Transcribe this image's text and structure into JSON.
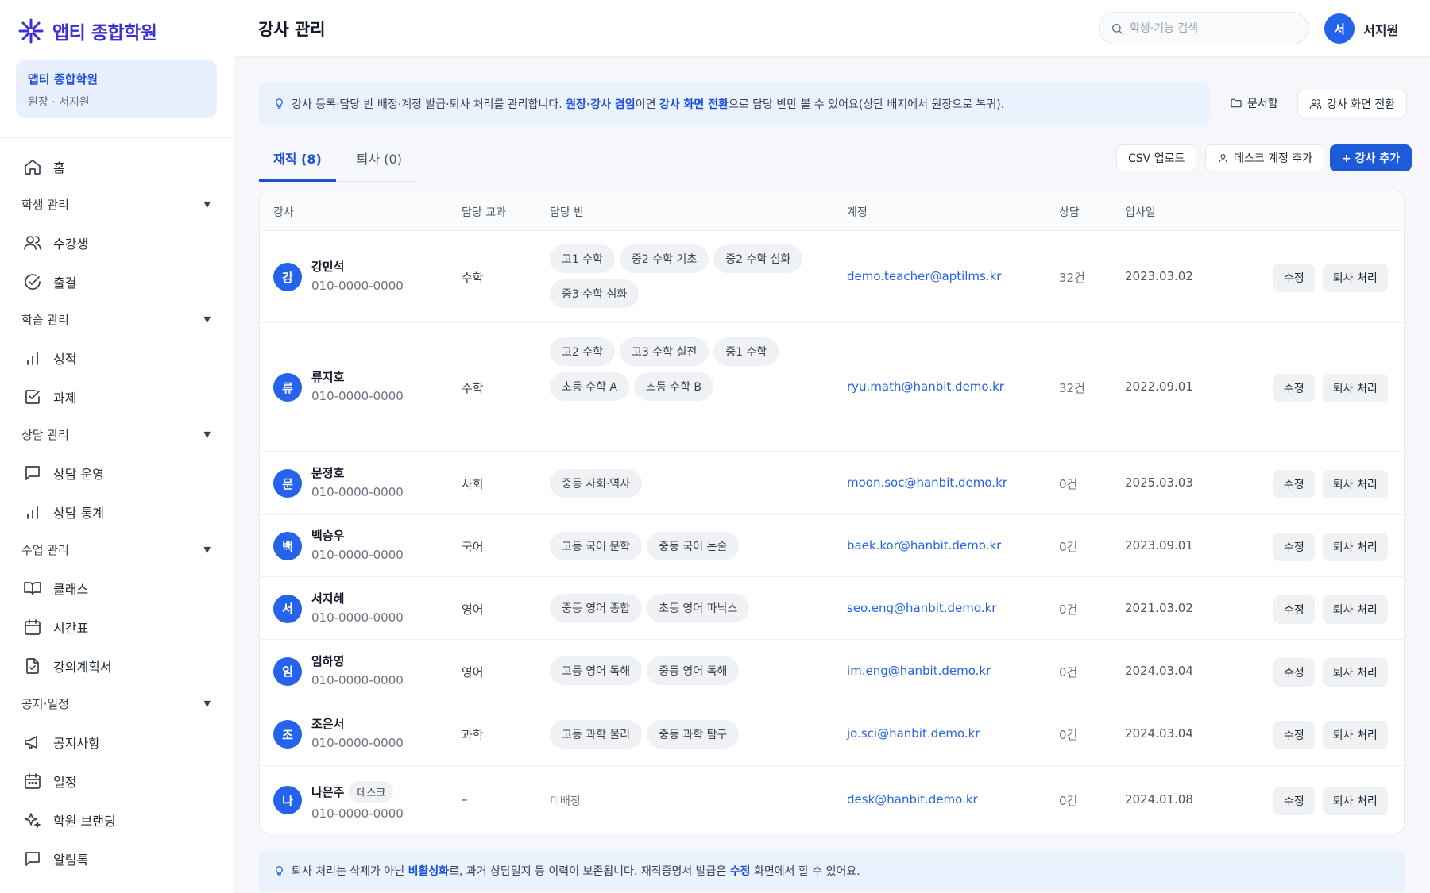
{
  "brand": {
    "name": "앱티 종합학원"
  },
  "org": {
    "name": "앱티 종합학원",
    "role": "원장 · 서지원"
  },
  "nav": {
    "home": "홈",
    "group_students": "학생 관리",
    "students": "수강생",
    "attendance": "출결",
    "group_learning": "학습 관리",
    "grades": "성적",
    "assignments": "과제",
    "group_consult": "상담 관리",
    "consult_ops": "상담 운영",
    "consult_stats": "상담 통계",
    "group_class": "수업 관리",
    "classes": "클래스",
    "timetable": "시간표",
    "syllabus": "강의계획서",
    "group_notice": "공지·일정",
    "notices": "공지사항",
    "schedule": "일정",
    "branding": "학원 브랜딩",
    "alimtalk": "알림톡"
  },
  "header": {
    "title": "강사 관리",
    "search_placeholder": "학생·기능 검색",
    "avatar": "서",
    "user": "서지원"
  },
  "info": {
    "p1": "강사 등록·담당 반 배정·계정 발급·퇴사 처리를 관리합니다. ",
    "b1": "원장·강사 겸임",
    "p2": "이면 ",
    "b2": "강사 화면 전환",
    "p3": "으로 담당 반만 볼 수 있어요(상단 배지에서 원장으로 복귀)."
  },
  "actions": {
    "docs": "문서함",
    "switch": "강사 화면 전환",
    "csv": "CSV 업로드",
    "add_desk": "데스크 계정 추가",
    "add_teacher": "+ 강사 추가"
  },
  "tabs": {
    "active": "재직 (8)",
    "retired": "퇴사 (0)"
  },
  "table": {
    "headers": {
      "teacher": "강사",
      "subject": "담당 교과",
      "classes": "담당 반",
      "account": "계정",
      "consult": "상담",
      "joined": "입사일"
    },
    "edit": "수정",
    "retire": "퇴사 처리",
    "rows": [
      {
        "initial": "강",
        "name": "강민석",
        "badge": "",
        "phone": "010-0000-0000",
        "subject": "수학",
        "classes": [
          "고1 수학",
          "중2 수학 기초",
          "중2 수학 심화",
          "중3 수학 심화"
        ],
        "email": "demo.teacher@aptilms.kr",
        "consult": "32건",
        "date": "2023.03.02"
      },
      {
        "initial": "류",
        "name": "류지호",
        "badge": "",
        "phone": "010-0000-0000",
        "subject": "수학",
        "classes": [
          "고2 수학",
          "고3 수학 실전",
          "중1 수학",
          "초등 수학 A",
          "초등 수학 B"
        ],
        "email": "ryu.math@hanbit.demo.kr",
        "consult": "32건",
        "date": "2022.09.01"
      },
      {
        "initial": "문",
        "name": "문정호",
        "badge": "",
        "phone": "010-0000-0000",
        "subject": "사회",
        "classes": [
          "중등 사회·역사"
        ],
        "email": "moon.soc@hanbit.demo.kr",
        "consult": "0건",
        "date": "2025.03.03"
      },
      {
        "initial": "백",
        "name": "백승우",
        "badge": "",
        "phone": "010-0000-0000",
        "subject": "국어",
        "classes": [
          "고등 국어 문학",
          "중등 국어 논술"
        ],
        "email": "baek.kor@hanbit.demo.kr",
        "consult": "0건",
        "date": "2023.09.01"
      },
      {
        "initial": "서",
        "name": "서지혜",
        "badge": "",
        "phone": "010-0000-0000",
        "subject": "영어",
        "classes": [
          "중등 영어 종합",
          "초등 영어 파닉스"
        ],
        "email": "seo.eng@hanbit.demo.kr",
        "consult": "0건",
        "date": "2021.03.02"
      },
      {
        "initial": "임",
        "name": "임하영",
        "badge": "",
        "phone": "010-0000-0000",
        "subject": "영어",
        "classes": [
          "고등 영어 독해",
          "중등 영어 독해"
        ],
        "email": "im.eng@hanbit.demo.kr",
        "consult": "0건",
        "date": "2024.03.04"
      },
      {
        "initial": "조",
        "name": "조은서",
        "badge": "",
        "phone": "010-0000-0000",
        "subject": "과학",
        "classes": [
          "고등 과학 물리",
          "중등 과학 탐구"
        ],
        "email": "jo.sci@hanbit.demo.kr",
        "consult": "0건",
        "date": "2024.03.04"
      },
      {
        "initial": "나",
        "name": "나은주",
        "badge": "데스크",
        "phone": "010-0000-0000",
        "subject": "–",
        "classes": [],
        "unassigned": "미배정",
        "email": "desk@hanbit.demo.kr",
        "consult": "0건",
        "date": "2024.01.08"
      }
    ]
  },
  "footnote": {
    "p1": "퇴사 처리는 삭제가 아닌 ",
    "b1": "비활성화",
    "p2": "로, 과거 상담일지 등 이력이 보존됩니다. 재직증명서 발급은 ",
    "b2": "수정",
    "p3": " 화면에서 할 수 있어요."
  }
}
